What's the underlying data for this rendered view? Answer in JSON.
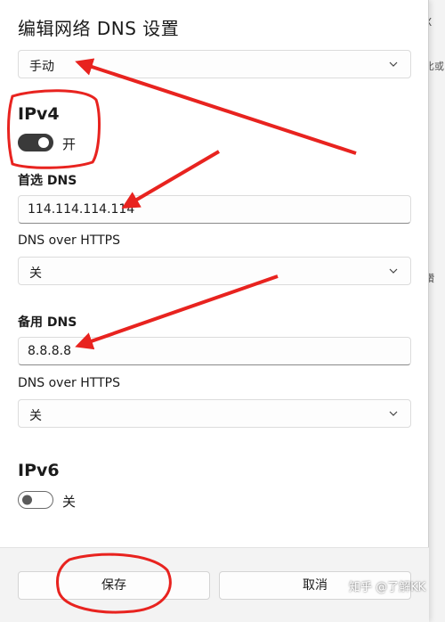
{
  "dialog": {
    "title": "编辑网络 DNS 设置",
    "mode_select": {
      "value": "手动",
      "icon": "chevron-down-icon"
    }
  },
  "ipv4": {
    "heading": "IPv4",
    "toggle": {
      "state": "on",
      "label": "开"
    },
    "preferred": {
      "label": "首选 DNS",
      "value": "114.114.114.114"
    },
    "preferred_doh": {
      "label": "DNS over HTTPS",
      "value": "关"
    },
    "alternate": {
      "label": "备用 DNS",
      "value": "8.8.8.8"
    },
    "alternate_doh": {
      "label": "DNS over HTTPS",
      "value": "关"
    }
  },
  "ipv6": {
    "heading": "IPv6",
    "toggle": {
      "state": "off",
      "label": "关"
    }
  },
  "footer": {
    "save_label": "保存",
    "cancel_label": "取消"
  },
  "background": {
    "fragment_1": "比或",
    "fragment_2": "鑽",
    "fragment_3": "X"
  },
  "watermark": "知乎 @了解KK",
  "colors": {
    "annotation_red": "#e8231f",
    "toggle_on": "#3a3a3a",
    "footer_bg": "#f3f3f3"
  }
}
